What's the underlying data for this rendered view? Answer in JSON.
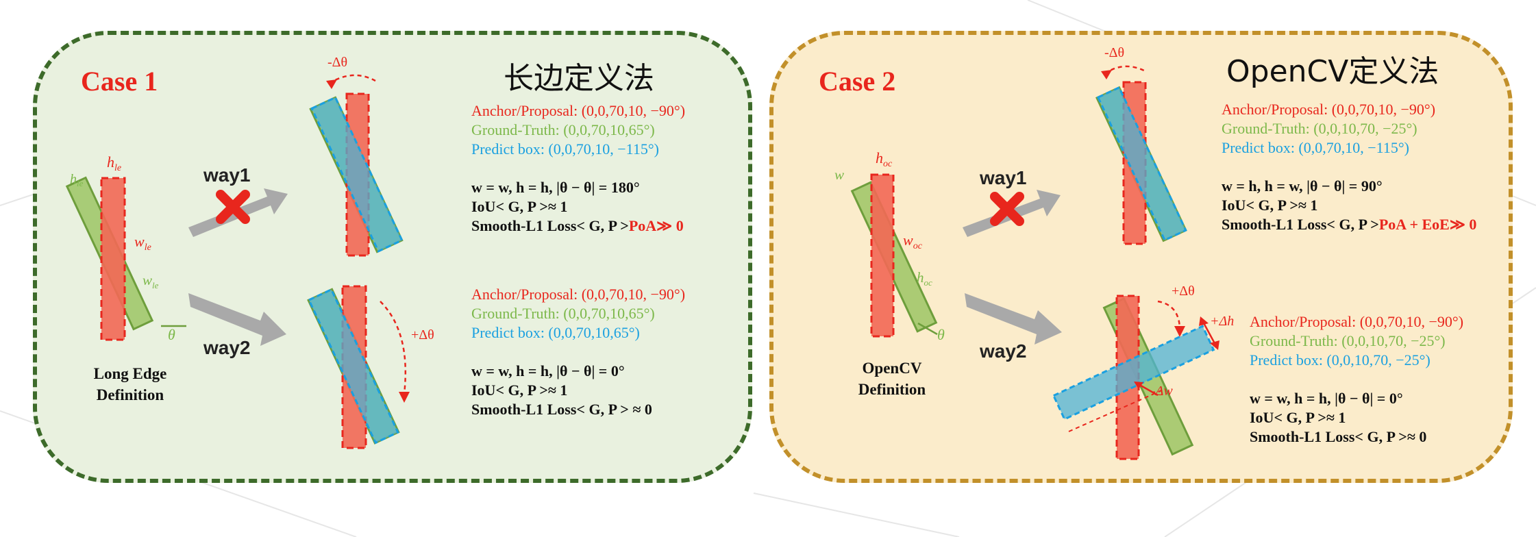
{
  "panels": {
    "case1": {
      "case_label": "Case 1",
      "title": "长边定义法",
      "definition_label": [
        "Long Edge",
        "Definition"
      ],
      "way1": "way1",
      "way2": "way2",
      "dims": {
        "h": "h",
        "h_sub": "le",
        "w": "w",
        "w_sub": "le",
        "theta": "θ",
        "minus_dtheta": "-Δθ",
        "plus_dtheta": "+Δθ"
      },
      "block_way1": {
        "anchor": "Anchor/Proposal: (0,0,70,10, −90°)",
        "gt": "Ground-Truth: (0,0,70,10,65°)",
        "pred": "Predict box: (0,0,70,10, −115°)",
        "eq": "w = w, h = h, |θ − θ| = 180°",
        "iou": "IoU< G, P >≈ 1",
        "loss": "Smooth-L1 Loss< G, P >",
        "loss_tail": "PoA≫ 0"
      },
      "block_way2": {
        "anchor": "Anchor/Proposal: (0,0,70,10, −90°)",
        "gt": "Ground-Truth: (0,0,70,10,65°)",
        "pred": "Predict box: (0,0,70,10,65°)",
        "eq": "w = w, h = h, |θ − θ| = 0°",
        "iou": "IoU< G, P >≈ 1",
        "loss": "Smooth-L1 Loss< G, P > ≈ 0"
      }
    },
    "case2": {
      "case_label": "Case 2",
      "title": "OpenCV定义法",
      "definition_label": [
        "OpenCV",
        "Definition"
      ],
      "way1": "way1",
      "way2": "way2",
      "dims": {
        "h": "h",
        "h_sub": "oc",
        "w": "w",
        "w_sub": "oc",
        "theta": "θ",
        "minus_dtheta": "-Δθ",
        "plus_dtheta": "+Δθ",
        "plus_dh": "+Δh",
        "minus_dw": "-Δw"
      },
      "block_way1": {
        "anchor": "Anchor/Proposal: (0,0,70,10, −90°)",
        "gt": "Ground-Truth: (0,0,10,70, −25°)",
        "pred": "Predict box: (0,0,70,10, −115°)",
        "eq": "w = h, h = w, |θ − θ| = 90°",
        "iou": "IoU< G, P >≈ 1",
        "loss": "Smooth-L1 Loss< G, P >",
        "loss_tail": "PoA + EoE≫ 0"
      },
      "block_way2": {
        "anchor": "Anchor/Proposal: (0,0,70,10, −90°)",
        "gt": "Ground-Truth: (0,0,10,70, −25°)",
        "pred": "Predict box: (0,0,10,70, −25°)",
        "eq": "w = w, h = h, |θ − θ| = 0°",
        "iou": "IoU< G, P >≈ 1",
        "loss": "Smooth-L1 Loss< G, P >≈ 0"
      }
    }
  },
  "colors": {
    "red": "#e8261d",
    "green": "#7cb84a",
    "blue": "#1aa0e0",
    "panel1_bg": "#e9f1df",
    "panel1_border": "#3d6b2a",
    "panel2_bg": "#fbeccb",
    "panel2_border": "#c2902a"
  }
}
